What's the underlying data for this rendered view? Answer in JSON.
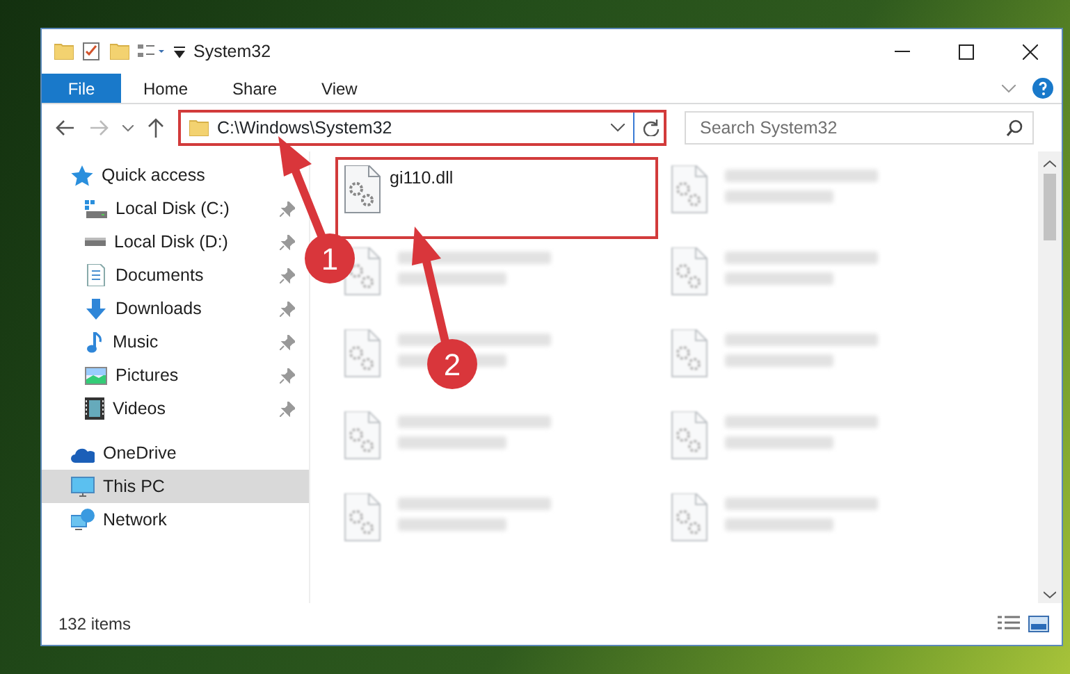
{
  "window": {
    "title": "System32"
  },
  "ribbon": {
    "file_tab": "File",
    "tabs": [
      "Home",
      "Share",
      "View"
    ]
  },
  "address": {
    "path": "C:\\Windows\\System32"
  },
  "search": {
    "placeholder": "Search System32"
  },
  "sidebar": {
    "items": [
      {
        "label": "Quick access",
        "kind": "quick",
        "selected": false,
        "children": [
          {
            "label": "Local Disk (C:)",
            "kind": "drive-c",
            "pinned": true,
            "selected": false
          },
          {
            "label": "Local Disk (D:)",
            "kind": "drive",
            "pinned": true,
            "selected": false
          },
          {
            "label": "Documents",
            "kind": "documents",
            "pinned": true,
            "selected": false
          },
          {
            "label": "Downloads",
            "kind": "downloads",
            "pinned": true,
            "selected": false
          },
          {
            "label": "Music",
            "kind": "music",
            "pinned": true,
            "selected": false
          },
          {
            "label": "Pictures",
            "kind": "pictures",
            "pinned": true,
            "selected": false
          },
          {
            "label": "Videos",
            "kind": "videos",
            "pinned": true,
            "selected": false
          }
        ]
      },
      {
        "label": "OneDrive",
        "kind": "onedrive",
        "selected": false
      },
      {
        "label": "This PC",
        "kind": "pc",
        "selected": true
      },
      {
        "label": "Network",
        "kind": "network",
        "selected": false
      }
    ]
  },
  "files": [
    {
      "name": "gi110.dll",
      "highlighted": true,
      "blurred": false
    },
    {
      "highlighted": false,
      "blurred": true
    },
    {
      "highlighted": false,
      "blurred": true
    },
    {
      "highlighted": false,
      "blurred": true
    },
    {
      "highlighted": false,
      "blurred": true
    },
    {
      "highlighted": false,
      "blurred": true
    },
    {
      "highlighted": false,
      "blurred": true
    },
    {
      "highlighted": false,
      "blurred": true
    },
    {
      "highlighted": false,
      "blurred": true
    },
    {
      "highlighted": false,
      "blurred": true
    }
  ],
  "status_bar": {
    "item_count": "132 items"
  },
  "annotations": [
    {
      "label": "1"
    },
    {
      "label": "2"
    }
  ]
}
